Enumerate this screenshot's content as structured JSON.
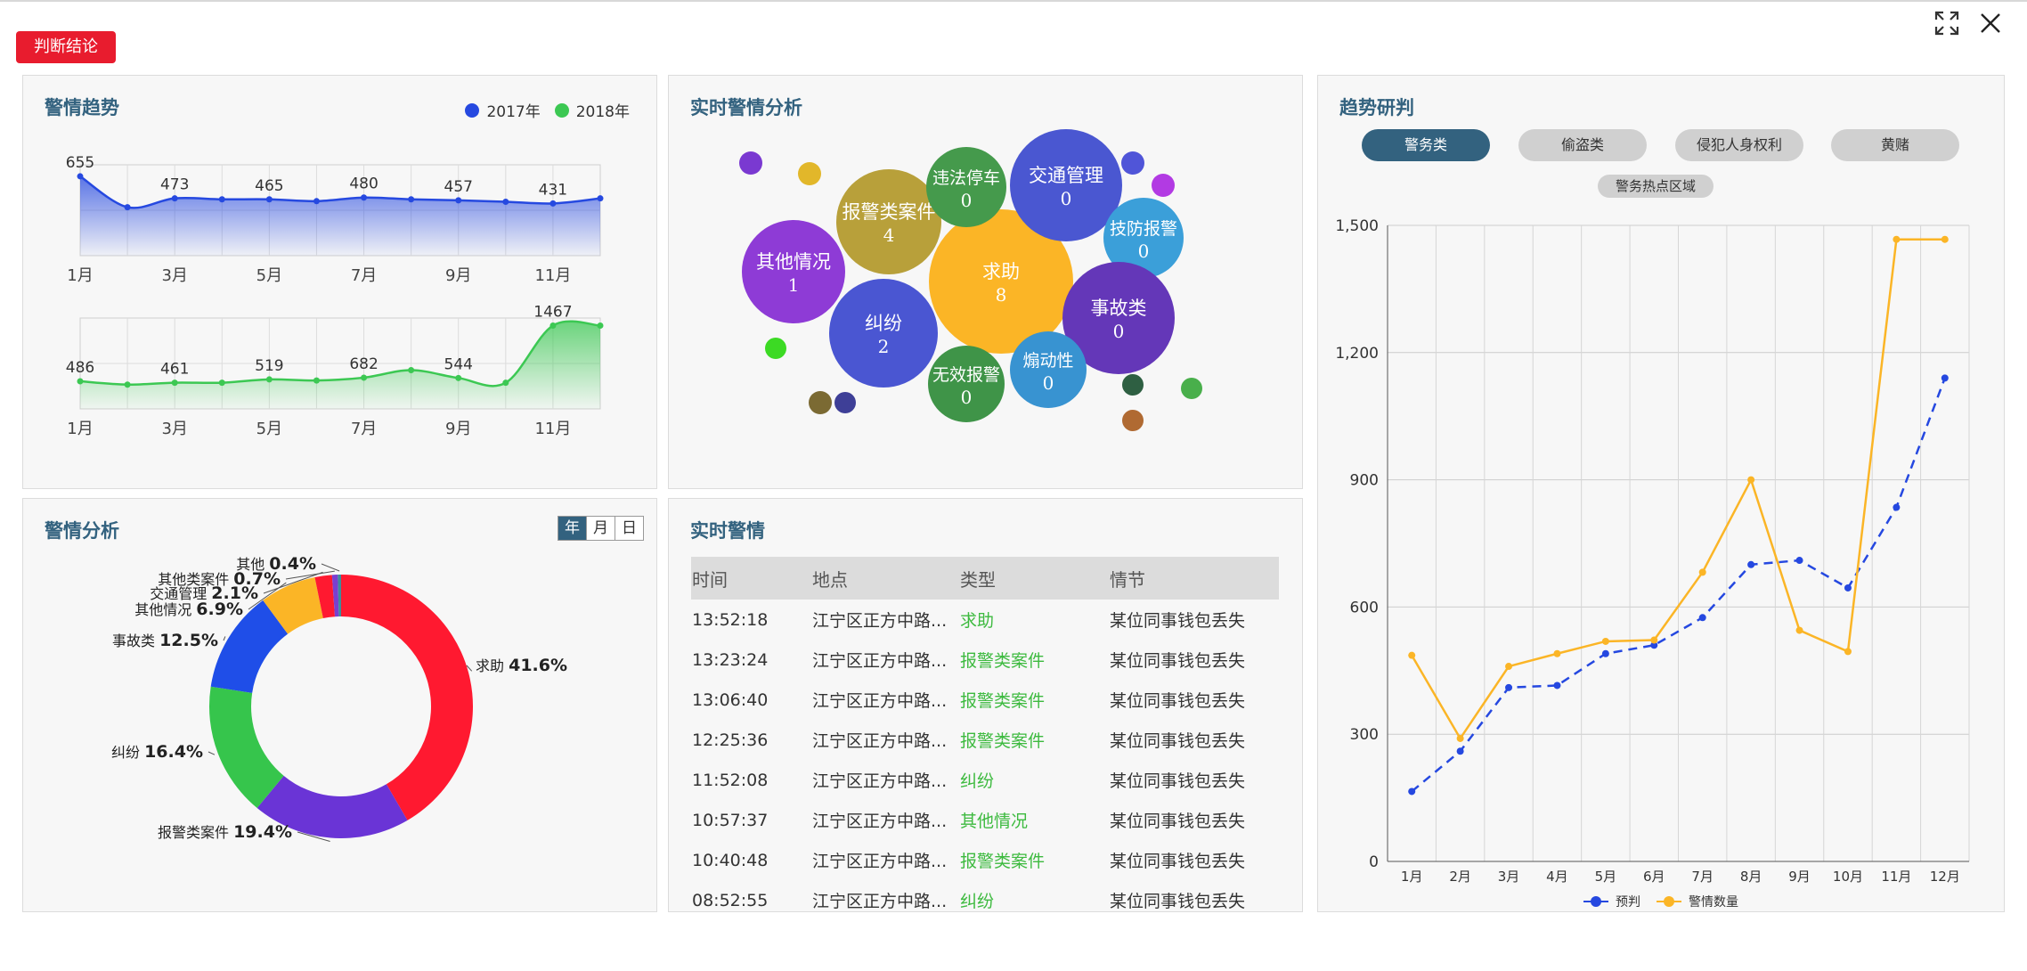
{
  "header": {
    "verdict_button": "判断结论",
    "expand_icon": "expand-icon",
    "close_icon": "close-icon"
  },
  "trend_panel": {
    "title": "警情趋势",
    "legend": [
      {
        "label": "2017年",
        "color": "#2649e0"
      },
      {
        "label": "2018年",
        "color": "#3cc853"
      }
    ],
    "month_ticks": [
      "1月",
      "3月",
      "5月",
      "7月",
      "9月",
      "11月"
    ]
  },
  "realtime_analysis_panel": {
    "title": "实时警情分析"
  },
  "research_panel": {
    "title": "趋势研判",
    "tabs": [
      "警务类",
      "偷盗类",
      "侵犯人身权利",
      "黄赌",
      "警务热点区域"
    ],
    "active_tab": 0
  },
  "analysis_panel": {
    "title": "警情分析",
    "periods": [
      "年",
      "月",
      "日"
    ],
    "active_period": 0
  },
  "alerts_panel": {
    "title": "实时警情",
    "columns": [
      "时间",
      "地点",
      "类型",
      "情节"
    ],
    "rows": [
      {
        "time": "13:52:18",
        "place": "江宁区正方中路...",
        "type": "求助",
        "detail": "某位同事钱包丢失"
      },
      {
        "time": "13:23:24",
        "place": "江宁区正方中路...",
        "type": "报警类案件",
        "detail": "某位同事钱包丢失"
      },
      {
        "time": "13:06:40",
        "place": "江宁区正方中路...",
        "type": "报警类案件",
        "detail": "某位同事钱包丢失"
      },
      {
        "time": "12:25:36",
        "place": "江宁区正方中路...",
        "type": "报警类案件",
        "detail": "某位同事钱包丢失"
      },
      {
        "time": "11:52:08",
        "place": "江宁区正方中路...",
        "type": "纠纷",
        "detail": "某位同事钱包丢失"
      },
      {
        "time": "10:57:37",
        "place": "江宁区正方中路...",
        "type": "其他情况",
        "detail": "某位同事钱包丢失"
      },
      {
        "time": "10:40:48",
        "place": "江宁区正方中路...",
        "type": "报警类案件",
        "detail": "某位同事钱包丢失"
      },
      {
        "time": "08:52:55",
        "place": "江宁区正方中路...",
        "type": "纠纷",
        "detail": "某位同事钱包丢失"
      }
    ]
  },
  "chart_data": [
    {
      "type": "area",
      "id": "trend-2017",
      "x": [
        "1月",
        "2月",
        "3月",
        "4月",
        "5月",
        "6月",
        "7月",
        "8月",
        "9月",
        "10月",
        "11月",
        "12月"
      ],
      "values": [
        655,
        400,
        473,
        465,
        465,
        450,
        480,
        465,
        457,
        445,
        431,
        473
      ],
      "point_labels": [
        655,
        null,
        473,
        null,
        465,
        null,
        480,
        null,
        457,
        null,
        431,
        null
      ],
      "series_name": "2017年",
      "color": "#2649e0",
      "ylim": [
        0,
        750
      ]
    },
    {
      "type": "area",
      "id": "trend-2018",
      "x": [
        "1月",
        "2月",
        "3月",
        "4月",
        "5月",
        "6月",
        "7月",
        "8月",
        "9月",
        "10月",
        "11月",
        "12月"
      ],
      "values": [
        486,
        427,
        461,
        461,
        519,
        500,
        550,
        682,
        544,
        460,
        1467,
        1467
      ],
      "point_labels": [
        486,
        null,
        461,
        null,
        519,
        null,
        682,
        null,
        544,
        null,
        1467,
        null
      ],
      "series_name": "2018年",
      "color": "#3cc853",
      "ylim": [
        0,
        1600
      ]
    },
    {
      "type": "bubble",
      "id": "realtime-bubbles",
      "items": [
        {
          "name": "求助",
          "value": "8",
          "color": "#fbb526"
        },
        {
          "name": "报警类案件",
          "value": "4",
          "color": "#b8a03a"
        },
        {
          "name": "其他情况",
          "value": "1",
          "color": "#8e3bd6"
        },
        {
          "name": "纠纷",
          "value": "2",
          "color": "#4a56d2"
        },
        {
          "name": "违法停车",
          "value": "0",
          "color": "#459a4c"
        },
        {
          "name": "交通管理",
          "value": "0",
          "color": "#4a57d1"
        },
        {
          "name": "技防报警",
          "value": "0",
          "color": "#3b9fd9"
        },
        {
          "name": "事故类",
          "value": "0",
          "color": "#6437b8"
        },
        {
          "name": "煽动性",
          "value": "0",
          "color": "#3893d1"
        },
        {
          "name": "无效报警",
          "value": "0",
          "color": "#3f9448"
        }
      ],
      "decor_colors": [
        "#7a39d1",
        "#e2b72a",
        "#5055d8",
        "#b23ae3",
        "#3cda24",
        "#7b6a33",
        "#3e3f97",
        "#2e5f42",
        "#49af4b",
        "#b06a32"
      ]
    },
    {
      "type": "pie",
      "id": "analysis-donut",
      "slices": [
        {
          "name": "求助",
          "value": 41.6,
          "label": "41.6%",
          "color": "#ff1930"
        },
        {
          "name": "报警类案件",
          "value": 19.4,
          "label": "19.4%",
          "color": "#6a34d6"
        },
        {
          "name": "纠纷",
          "value": 16.4,
          "label": "16.4%",
          "color": "#36c54c"
        },
        {
          "name": "事故类",
          "value": 12.5,
          "label": "12.5%",
          "color": "#1f4ee8"
        },
        {
          "name": "其他情况",
          "value": 6.9,
          "label": "6.9%",
          "color": "#fbb526"
        },
        {
          "name": "交通管理",
          "value": 2.1,
          "label": "2.1%",
          "color": "#ff1930"
        },
        {
          "name": "其他类案件",
          "value": 0.7,
          "label": "0.7%",
          "color": "#7a3fd0"
        },
        {
          "name": "其他",
          "value": 0.4,
          "label": "0.4%",
          "color": "#3f8c9a"
        }
      ]
    },
    {
      "type": "line",
      "id": "research-line",
      "categories": [
        "1月",
        "2月",
        "3月",
        "4月",
        "5月",
        "6月",
        "7月",
        "8月",
        "9月",
        "10月",
        "11月",
        "12月"
      ],
      "series": [
        {
          "name": "预判",
          "values": [
            165,
            260,
            410,
            415,
            490,
            510,
            575,
            700,
            710,
            645,
            835,
            1140
          ],
          "color": "#2548e0",
          "dashed": true
        },
        {
          "name": "警情数量",
          "values": [
            486,
            290,
            460,
            490,
            519,
            522,
            682,
            900,
            545,
            495,
            1467,
            1467
          ],
          "color": "#fbb526",
          "dashed": false
        }
      ],
      "ylim": [
        0,
        1500
      ],
      "yticks": [
        "0",
        "300",
        "600",
        "900",
        "1,200",
        "1,500"
      ],
      "grid": true,
      "legend_position": "bottom"
    }
  ]
}
